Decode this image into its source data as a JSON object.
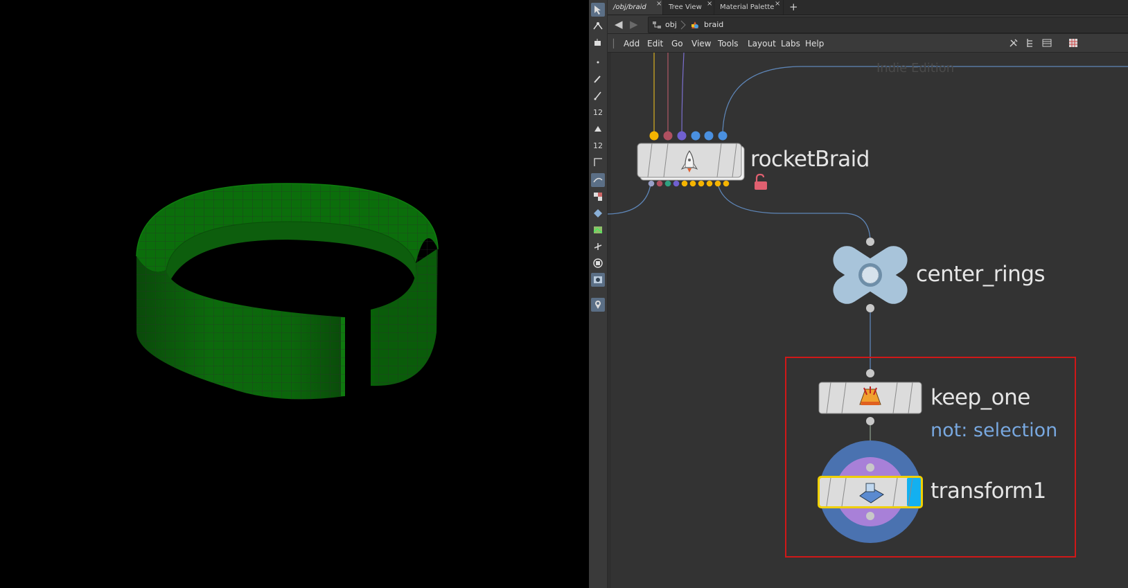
{
  "viewport": {
    "background": "#000000",
    "geometry_color": "#0a6e0a",
    "wire_color": "#2f2f2f"
  },
  "toolbox": {
    "tools": [
      {
        "name": "select-icon",
        "glyph": ""
      },
      {
        "name": "transform-pose-icon",
        "glyph": ""
      },
      {
        "name": "handle-icon",
        "glyph": ""
      },
      {
        "name": "point-icon",
        "glyph": "•"
      },
      {
        "name": "brush-icon",
        "glyph": ""
      },
      {
        "name": "pen-icon",
        "glyph": ""
      },
      {
        "name": "number-12-icon",
        "glyph": "12"
      },
      {
        "name": "sculpt-icon",
        "glyph": ""
      },
      {
        "name": "number-12-alt-icon",
        "glyph": "12"
      },
      {
        "name": "measure-icon",
        "glyph": ""
      },
      {
        "name": "view-tool-icon",
        "glyph": ""
      },
      {
        "name": "checker-icon",
        "glyph": ""
      },
      {
        "name": "diamond-icon",
        "glyph": ""
      },
      {
        "name": "landscape-icon",
        "glyph": ""
      },
      {
        "name": "gizmo-icon",
        "glyph": ""
      },
      {
        "name": "circle-stop-icon",
        "glyph": ""
      },
      {
        "name": "snapshot-icon",
        "glyph": ""
      },
      {
        "name": "location-pin-icon",
        "glyph": ""
      }
    ]
  },
  "tabs": [
    {
      "label": "/obj/braid",
      "active": true
    },
    {
      "label": "Tree View",
      "active": false
    },
    {
      "label": "Material Palette",
      "active": false
    }
  ],
  "tab_close_glyph": "×",
  "tab_add_glyph": "+",
  "path": {
    "back_glyph": "◀",
    "forward_glyph": "▶",
    "crumbs": [
      "obj",
      "braid"
    ]
  },
  "menu": [
    "Add",
    "Edit",
    "Go",
    "View",
    "Tools",
    "Layout",
    "Labs",
    "Help"
  ],
  "watermark": "Indie Edition",
  "nodes": {
    "rocketBraid": {
      "label": "rocketBraid"
    },
    "center_rings": {
      "label": "center_rings"
    },
    "keep_one": {
      "label": "keep_one",
      "comment": "not: selection"
    },
    "transform1": {
      "label": "transform1"
    }
  },
  "colors": {
    "wire": "#5e86b8",
    "input_yellow": "#f5b400",
    "input_red": "#b05060",
    "input_purple": "#7060d0",
    "input_blue": "#4a90e0",
    "display_flag": "#13b0f0",
    "selection_outline": "#f0d000",
    "annotation_box": "#d01818",
    "lock": "#e06070"
  }
}
